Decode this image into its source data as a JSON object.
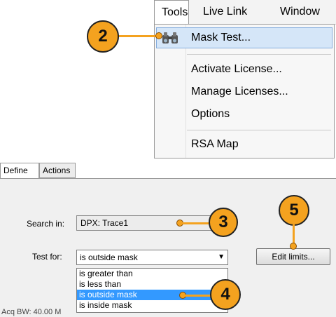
{
  "menubar": {
    "items": [
      "Tools",
      "Live Link",
      "Window"
    ]
  },
  "tools_menu": {
    "items": [
      {
        "label": "Mask Test...",
        "icon": "binoculars-icon",
        "highlighted": true
      },
      {
        "label": "Activate License..."
      },
      {
        "label": "Manage Licenses..."
      },
      {
        "label": "Options"
      },
      {
        "label": "RSA Map"
      }
    ]
  },
  "tabs": [
    "Define",
    "Actions"
  ],
  "form": {
    "search_label": "Search in:",
    "search_value": "DPX: Trace1",
    "test_label": "Test for:",
    "test_value": "is outside mask",
    "options": [
      "is greater than",
      "is less than",
      "is outside mask",
      "is inside mask"
    ],
    "selected_option": "is outside mask",
    "edit_limits_label": "Edit limits..."
  },
  "status": {
    "text": "Acq BW: 40.00 M"
  },
  "callouts": [
    "2",
    "3",
    "4",
    "5"
  ],
  "colors": {
    "callout": "#f4a21f",
    "highlight": "#d5e6f8",
    "selection": "#3399ff"
  }
}
